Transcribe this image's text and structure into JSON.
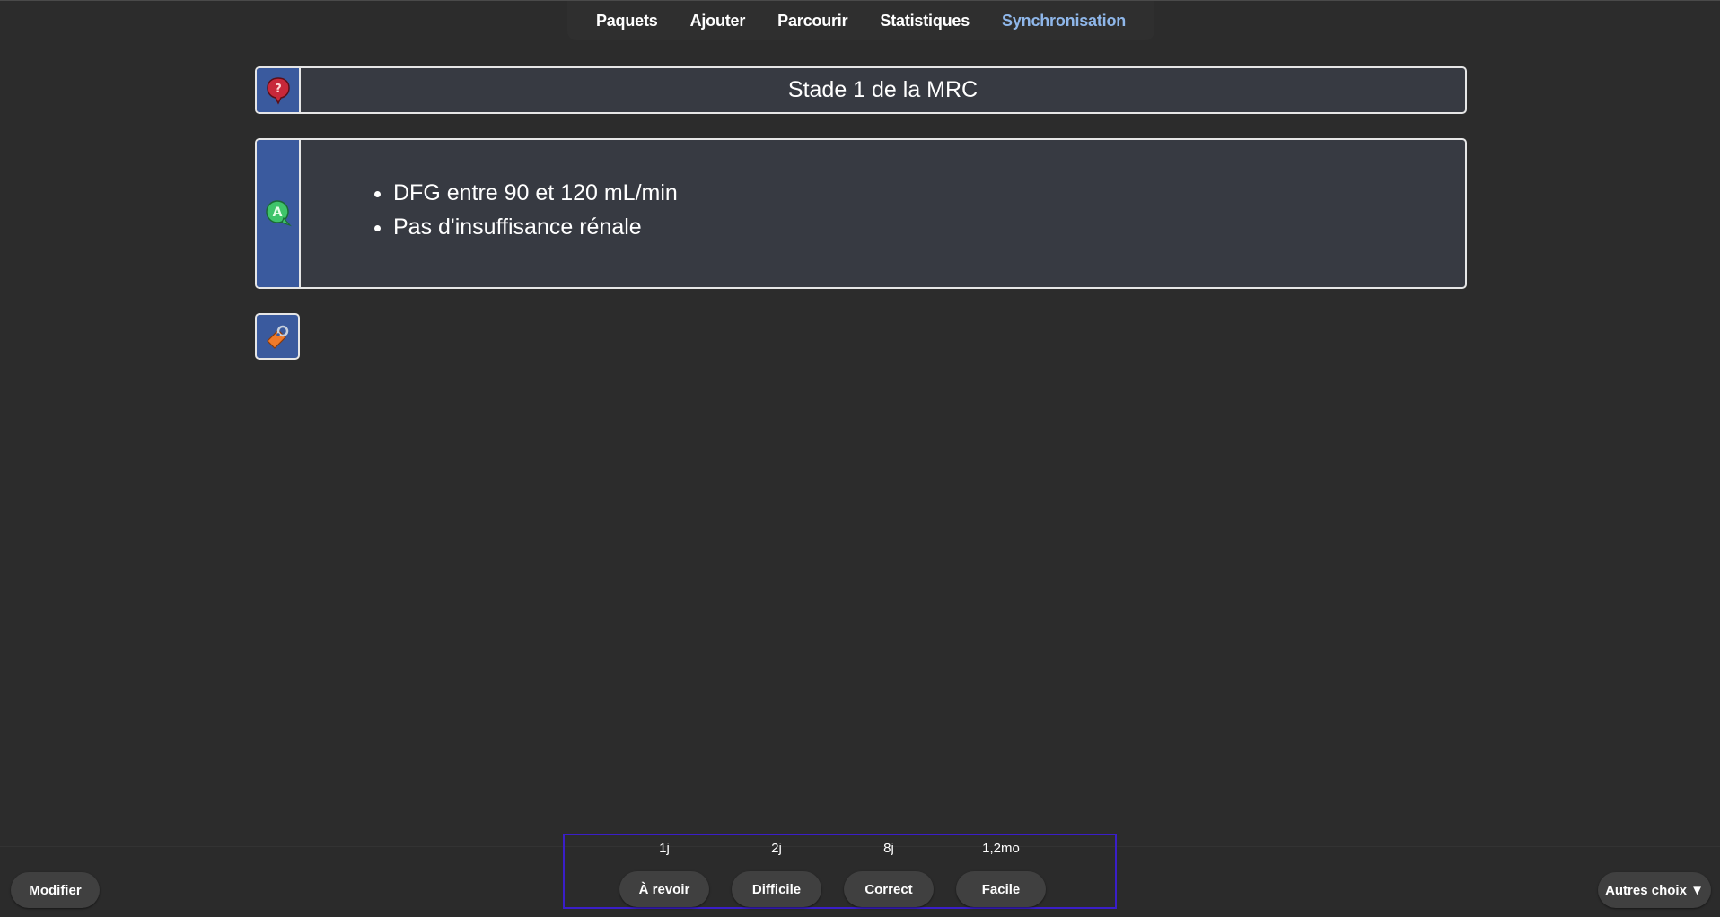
{
  "nav": {
    "items": [
      {
        "label": "Paquets"
      },
      {
        "label": "Ajouter"
      },
      {
        "label": "Parcourir"
      },
      {
        "label": "Statistiques"
      },
      {
        "label": "Synchronisation"
      }
    ],
    "active_color": "#8fb7ea"
  },
  "card": {
    "question": "Stade 1 de la MRC",
    "answer_items": [
      "DFG entre 90 et 120 mL/min",
      "Pas d'insuffisance rénale"
    ],
    "side_color": "#3a5a9e",
    "icons": {
      "question": "question-bubble-icon",
      "answer": "answer-bubble-icon",
      "tag": "tag-icon"
    }
  },
  "bottom": {
    "edit_label": "Modifier",
    "more_label": "Autres choix ▼",
    "answers": [
      {
        "interval": "1j",
        "label": "À revoir"
      },
      {
        "interval": "2j",
        "label": "Difficile"
      },
      {
        "interval": "8j",
        "label": "Correct"
      },
      {
        "interval": "1,2mo",
        "label": "Facile"
      }
    ]
  }
}
